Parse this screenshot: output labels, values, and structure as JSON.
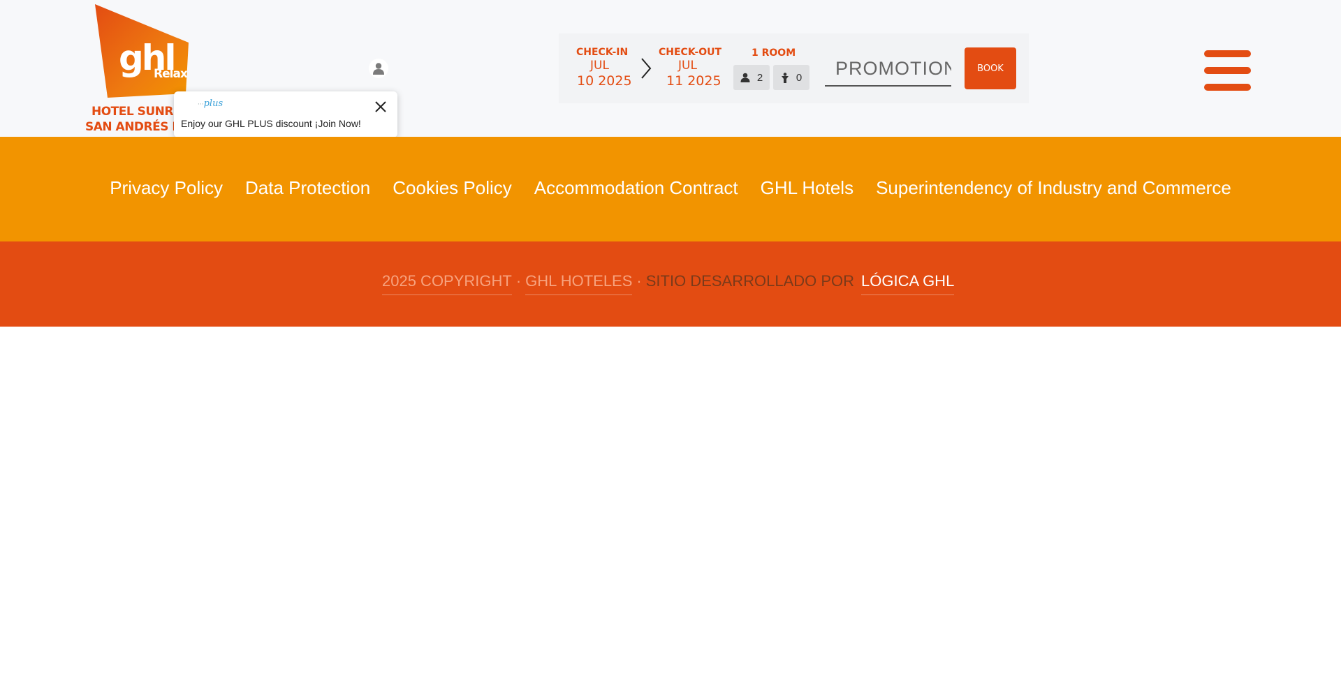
{
  "colors": {
    "orange": "#f29400",
    "red_orange": "#e34c12",
    "header_bg": "#f7f8fa"
  },
  "logo": {
    "brand": "ghl",
    "sub": "Relax",
    "line1": "HOTEL SUNRI",
    "line2": "SAN ANDRÉS IS"
  },
  "popup": {
    "logo_text": "plus",
    "text": "Enjoy our GHL PLUS discount ¡Join Now!"
  },
  "booking": {
    "checkin_label": "CHECK-IN",
    "checkin_month": "JUL",
    "checkin_date": "10 2025",
    "checkout_label": "CHECK-OUT",
    "checkout_month": "JUL",
    "checkout_date": "11 2025",
    "rooms_label": "1 ROOM",
    "adults": "2",
    "children": "0",
    "promo_placeholder": "PROMOTION",
    "book_label": "BOOK"
  },
  "footer_links": [
    "Privacy Policy",
    "Data Protection",
    "Cookies Policy",
    "Accommodation Contract",
    "GHL Hotels",
    "Superintendency of Industry and Commerce"
  ],
  "copyright": {
    "year_text": "2025 COPYRIGHT",
    "company": "GHL HOTELES",
    "developed_by": "SITIO DESARROLLADO POR",
    "developer": "LÓGICA GHL"
  },
  "icons": {
    "user": "user-icon",
    "close": "close-icon",
    "chevron": "chevron-right-icon",
    "adult": "adult-icon",
    "child": "child-icon",
    "menu": "hamburger-menu-icon"
  }
}
